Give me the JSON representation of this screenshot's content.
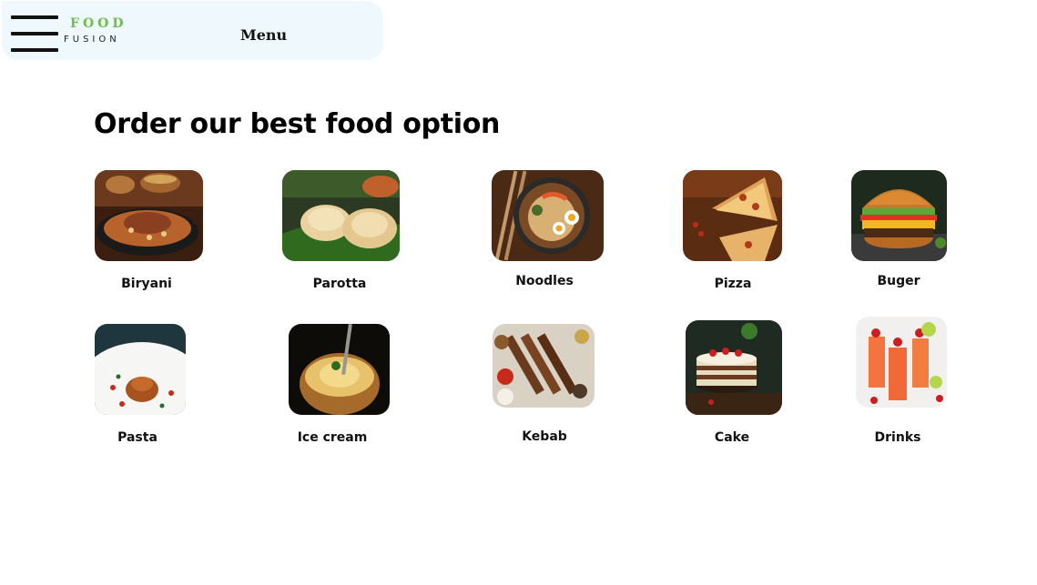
{
  "header": {
    "brand_top": "FOOD",
    "brand_bottom": "FUSION",
    "menu_label": "Menu",
    "menu_icon": "hamburger-menu-icon"
  },
  "main": {
    "heading": "Order our best food option"
  },
  "foods": [
    {
      "label": "Biryani"
    },
    {
      "label": "Parotta"
    },
    {
      "label": "Noodles"
    },
    {
      "label": "Pizza"
    },
    {
      "label": "Buger"
    },
    {
      "label": "Pasta"
    },
    {
      "label": "Ice cream"
    },
    {
      "label": "Kebab"
    },
    {
      "label": "Cake"
    },
    {
      "label": "Drinks"
    }
  ],
  "colors": {
    "header_bg": "#eef8fd",
    "brand_green": "#6cbf4b",
    "text": "#111111"
  }
}
